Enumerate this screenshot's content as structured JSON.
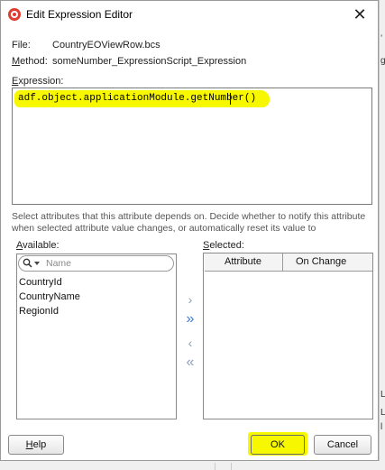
{
  "dialog": {
    "title": "Edit Expression Editor",
    "close_glyph": "✕"
  },
  "info": {
    "file_label": "File:",
    "file_value": "CountryEOViewRow.bcs",
    "method_label_first": "M",
    "method_label_rest": "ethod:",
    "method_value": "someNumber_ExpressionScript_Expression"
  },
  "expression": {
    "label_first": "E",
    "label_rest": "xpression:",
    "text": "adf.object.applicationModule.getNumber()"
  },
  "description": "Select attributes that this attribute depends on. Decide whether to notify this attribute when selected attribute value changes, or automatically reset its value to",
  "available": {
    "label_first": "A",
    "label_rest": "vailable:",
    "search_placeholder": "Name",
    "items": [
      "CountryId",
      "CountryName",
      "RegionId"
    ]
  },
  "selected": {
    "label_first": "S",
    "label_rest": "elected:",
    "columns": [
      "Attribute",
      "On Change"
    ]
  },
  "shuttle": {
    "move_right": "›",
    "move_all_right": "»",
    "move_left": "‹",
    "move_all_left": "«"
  },
  "buttons": {
    "help_first": "H",
    "help_rest": "elp",
    "ok": "OK",
    "cancel": "Cancel"
  },
  "background": {
    "side_chars": [
      "ʼ",
      "ɡ",
      "L",
      "L",
      "l"
    ]
  },
  "colors": {
    "highlight": "#f7f700",
    "shuttle_active": "#3a7bd5",
    "app_icon": "#e03c31"
  }
}
